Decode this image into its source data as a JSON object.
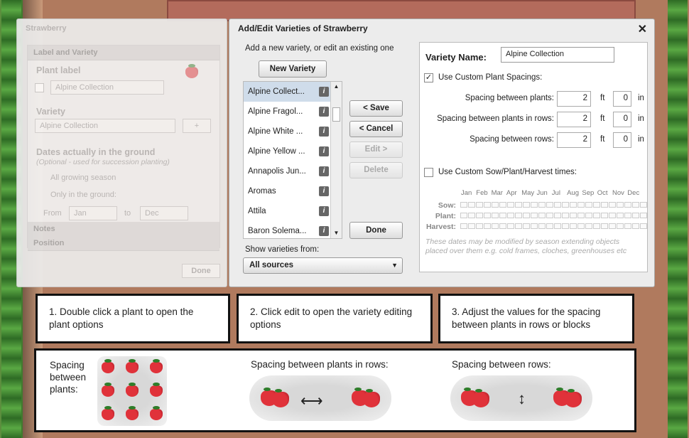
{
  "left_panel": {
    "title": "Strawberry",
    "section_label": "Label and Variety",
    "plant_label_heading": "Plant label",
    "plant_label_value": "Alpine Collection",
    "variety_heading": "Variety",
    "variety_value": "Alpine Collection",
    "add_button": "+",
    "dates_heading": "Dates actually in the ground",
    "dates_sub": "(Optional - used for succession planting)",
    "radio_all": "All growing season",
    "radio_only": "Only in the ground:",
    "from_label": "From",
    "from_value": "Jan",
    "to_label": "to",
    "to_value": "Dec",
    "notes": "Notes",
    "position": "Position",
    "done": "Done"
  },
  "dialog": {
    "title": "Add/Edit Varieties of Strawberry",
    "close": "✕",
    "prompt": "Add a new variety, or edit an existing one",
    "new_variety": "New Variety",
    "varieties": [
      "Alpine Collect...",
      "Alpine Fragol...",
      "Alpine White ...",
      "Alpine Yellow ...",
      "Annapolis Jun...",
      "Aromas",
      "Attila",
      "Baron Solema..."
    ],
    "info_glyph": "i",
    "save": "< Save",
    "cancel": "< Cancel",
    "edit": "Edit >",
    "delete": "Delete",
    "done": "Done",
    "show_from": "Show varieties from:",
    "source": "All sources"
  },
  "details": {
    "variety_name_label": "Variety Name:",
    "variety_name_value": "Alpine Collection",
    "custom_spacing_label": "Use Custom Plant Spacings:",
    "spacing_plants": "Spacing between plants:",
    "spacing_rows_plants": "Spacing between plants in rows:",
    "spacing_rows": "Spacing between rows:",
    "ft": "ft",
    "in": "in",
    "v1_ft": "2",
    "v1_in": "0",
    "v2_ft": "2",
    "v2_in": "0",
    "v3_ft": "2",
    "v3_in": "0",
    "custom_sow_label": "Use Custom Sow/Plant/Harvest times:",
    "months": [
      "Jan",
      "Feb",
      "Mar",
      "Apr",
      "May",
      "Jun",
      "Jul",
      "Aug",
      "Sep",
      "Oct",
      "Nov",
      "Dec"
    ],
    "sow": "Sow:",
    "plant": "Plant:",
    "harvest": "Harvest:",
    "note": "These dates may be modified by season extending objects placed over them e.g. cold frames, cloches, greenhouses etc",
    "check": "✓"
  },
  "instructions": {
    "step1": "1. Double click a plant to open the plant options",
    "step2": "2. Click edit to open the variety editing options",
    "step3": "3. Adjust the values for the spacing between plants in rows or blocks"
  },
  "diagram": {
    "label1": "Spacing between plants:",
    "label2": "Spacing between plants in rows:",
    "label3": "Spacing between rows:"
  }
}
